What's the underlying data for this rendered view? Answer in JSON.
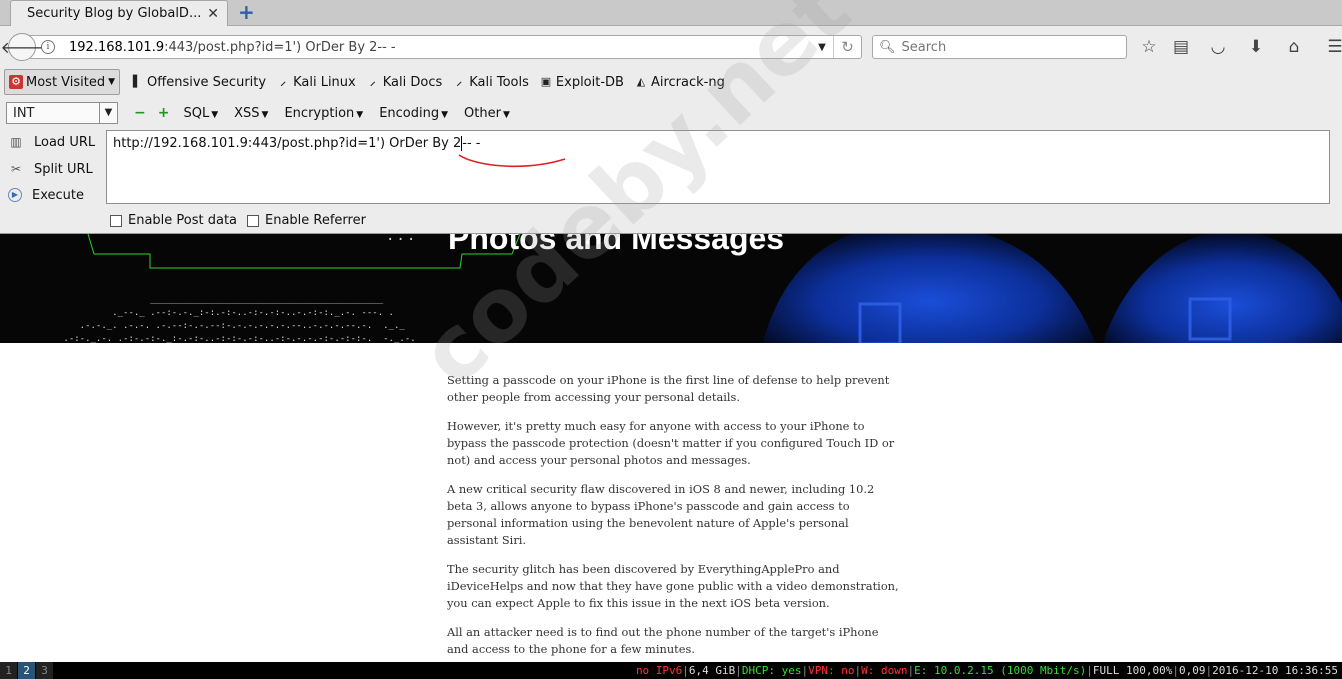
{
  "tab": {
    "title": "Security Blog by GlobalD...",
    "close": "✕",
    "new_tab": "+"
  },
  "nav": {
    "url_host": "192.168.101.9",
    "url_rest": ":443/post.php?id=1') OrDer By 2-- -",
    "search_placeholder": "Search"
  },
  "bookmarks": {
    "most_visited": "Most Visited",
    "items": [
      "Offensive Security",
      "Kali Linux",
      "Kali Docs",
      "Kali Tools",
      "Exploit-DB",
      "Aircrack-ng"
    ]
  },
  "hackbar": {
    "select_value": "INT",
    "plus": "+",
    "minus": "−",
    "menus": [
      "SQL",
      "XSS",
      "Encryption",
      "Encoding",
      "Other"
    ],
    "load_url": "Load URL",
    "split_url": "Split URL",
    "execute": "Execute",
    "url_before_caret": "http://192.168.101.9:443/post.php?id=1') OrDer By 2",
    "url_after_caret": "-- -",
    "enable_post": "Enable Post data",
    "enable_referrer": "Enable Referrer"
  },
  "hero": {
    "title": "Photos and Messages"
  },
  "article": {
    "paragraphs": [
      "Setting a passcode on your iPhone is the first line of defense to help prevent other people from accessing your personal details.",
      "However, it's pretty much easy for anyone with access to your iPhone to bypass the passcode protection (doesn't matter if you configured Touch ID or not) and access your personal photos and messages.",
      "A new critical security flaw discovered in iOS 8 and newer, including 10.2 beta 3, allows anyone to bypass iPhone's passcode and gain access to personal information using the benevolent nature of Apple's personal assistant Siri.",
      "The security glitch has been discovered by EverythingApplePro and iDeviceHelps and now that they have gone public with a video demonstration, you can expect Apple to fix this issue in the next iOS beta version.",
      "All an attacker need is to find out the phone number of the target's iPhone and access to the phone for a few minutes."
    ]
  },
  "watermark": "codeby.net",
  "statusbar": {
    "workspaces": [
      "1",
      "2",
      "3"
    ],
    "active_workspace": "2",
    "ipv6": "no IPv6",
    "disk": "6,4 GiB",
    "dhcp": "DHCP: yes",
    "vpn": "VPN: no",
    "wifi": "W: down",
    "ethernet": "E: 10.0.2.15 (1000 Mbit/s)",
    "battery": "FULL 100,00%",
    "load": "0,09",
    "datetime": "2016-12-10 16:36:55"
  }
}
